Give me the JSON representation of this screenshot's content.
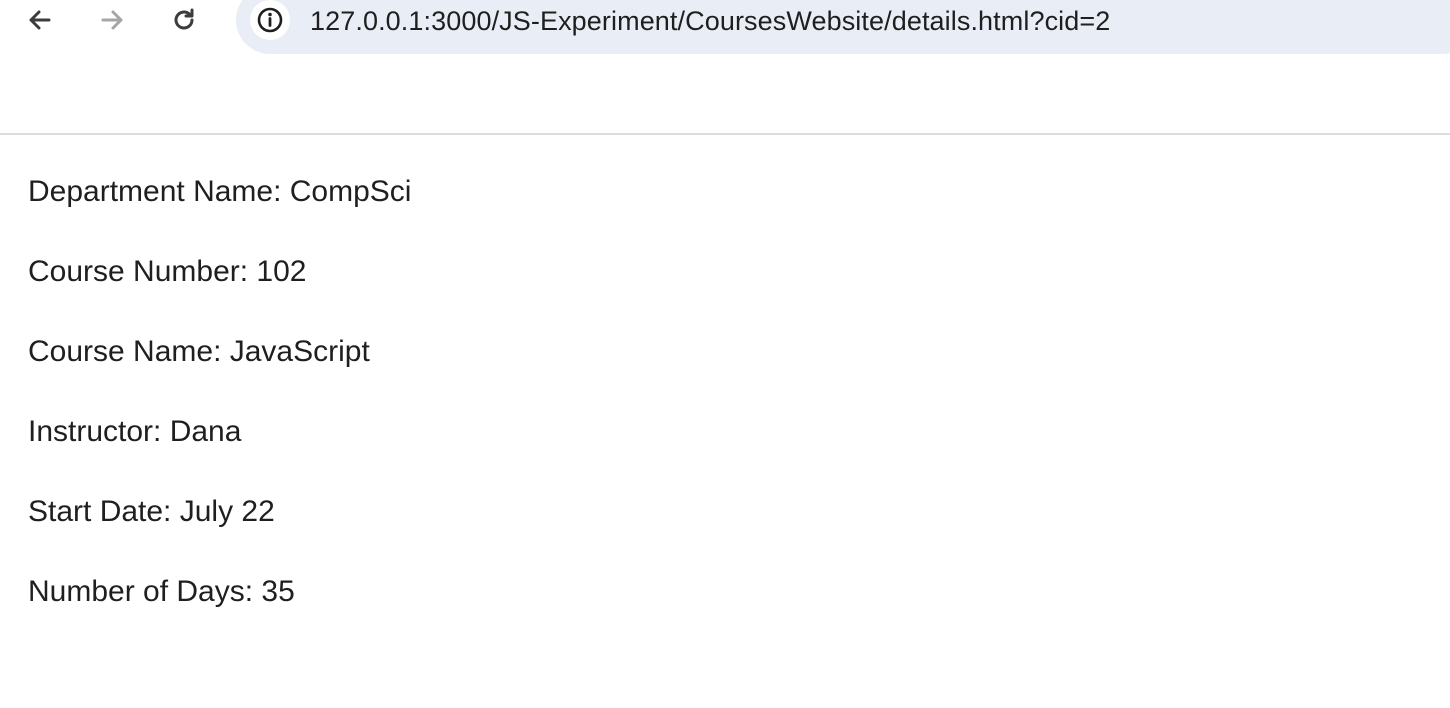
{
  "browser": {
    "url": "127.0.0.1:3000/JS-Experiment/CoursesWebsite/details.html?cid=2",
    "icons": {
      "back": "arrow-left-icon",
      "forward": "arrow-right-icon",
      "reload": "reload-icon",
      "site_info": "info-icon"
    }
  },
  "course": {
    "department": "Department Name: CompSci",
    "number": "Course Number: 102",
    "name": "Course Name: JavaScript",
    "instructor": "Instructor: Dana",
    "start_date": "Start Date: July 22",
    "days": "Number of Days: 35"
  }
}
